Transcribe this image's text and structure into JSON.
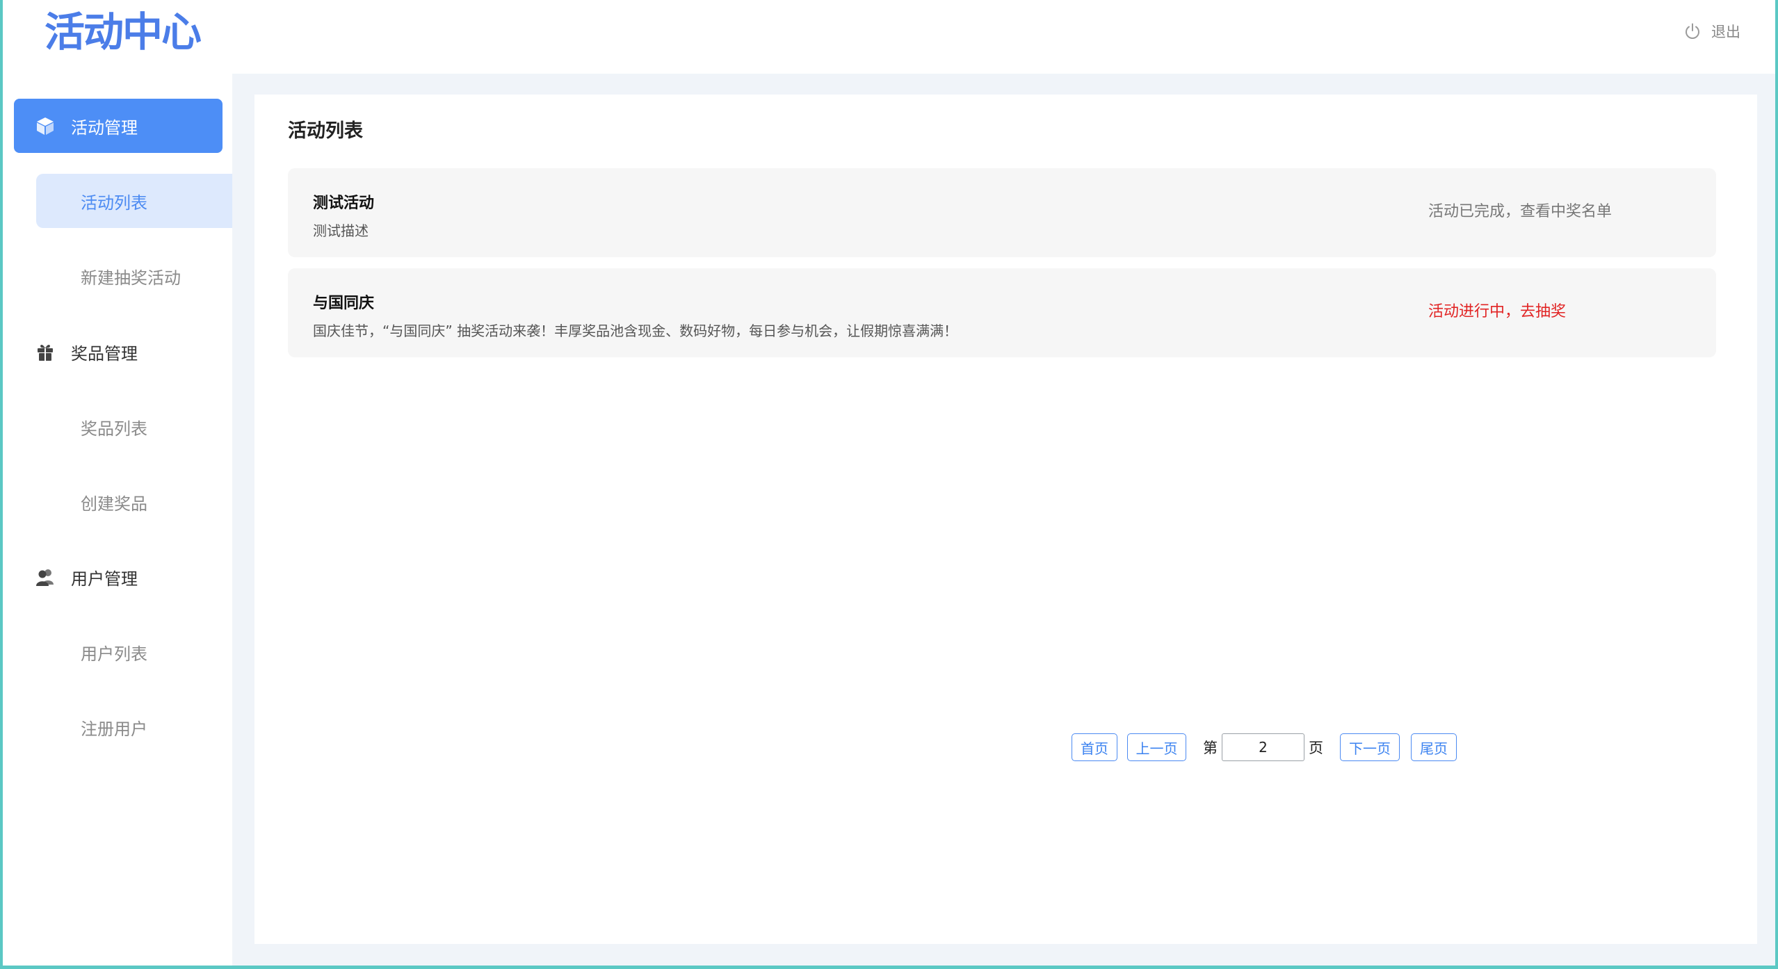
{
  "header": {
    "logo_text": "活动中心",
    "logout_label": "退出"
  },
  "sidebar": {
    "groups": [
      {
        "label": "活动管理",
        "icon": "cube-icon",
        "items": [
          {
            "label": "活动列表"
          },
          {
            "label": "新建抽奖活动"
          }
        ]
      },
      {
        "label": "奖品管理",
        "icon": "gift-icon",
        "items": [
          {
            "label": "奖品列表"
          },
          {
            "label": "创建奖品"
          }
        ]
      },
      {
        "label": "用户管理",
        "icon": "users-icon",
        "items": [
          {
            "label": "用户列表"
          },
          {
            "label": "注册用户"
          }
        ]
      }
    ]
  },
  "main": {
    "title": "活动列表",
    "activities": [
      {
        "title": "测试活动",
        "description": "测试描述",
        "status": "活动已完成，查看中奖名单"
      },
      {
        "title": "与国同庆",
        "description": "国庆佳节，“与国同庆” 抽奖活动来袭！丰厚奖品池含现金、数码好物，每日参与机会，让假期惊喜满满！",
        "status": "活动进行中，去抽奖"
      }
    ]
  },
  "pagination": {
    "first": "首页",
    "prev": "上一页",
    "page_prefix": "第",
    "page_value": "2",
    "page_suffix": "页",
    "next": "下一页",
    "last": "尾页"
  },
  "colors": {
    "accent": "#4d8ef6",
    "active_sub_bg": "#dde9fd",
    "live_status": "#e12424",
    "frame_border": "#5bc8c4"
  }
}
